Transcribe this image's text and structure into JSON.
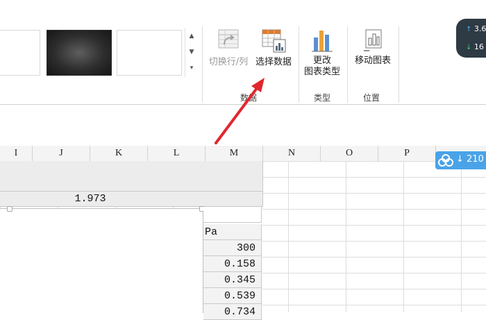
{
  "ribbon": {
    "buttons": {
      "switch_row_col": "切换行/列",
      "select_data": "选择数据",
      "change_chart_type_line1": "更改",
      "change_chart_type_line2": "图表类型",
      "move_chart": "移动图表"
    },
    "groups": {
      "data": "数据",
      "type": "类型",
      "location": "位置"
    }
  },
  "speed_widget": {
    "up": "3.6",
    "down": "16"
  },
  "cloud_badge": {
    "text": "210"
  },
  "columns": [
    "I",
    "J",
    "K",
    "L",
    "M",
    "N",
    "O",
    "P"
  ],
  "cells": {
    "merged_value": "1.973",
    "m_header": "Pa",
    "m_values": [
      "300",
      "0.158",
      "0.345",
      "0.539",
      "0.734"
    ]
  },
  "colors": {
    "arrow": "#e0262e",
    "cloud": "#4aa3e8",
    "speed_bg": "#2e3a44"
  }
}
